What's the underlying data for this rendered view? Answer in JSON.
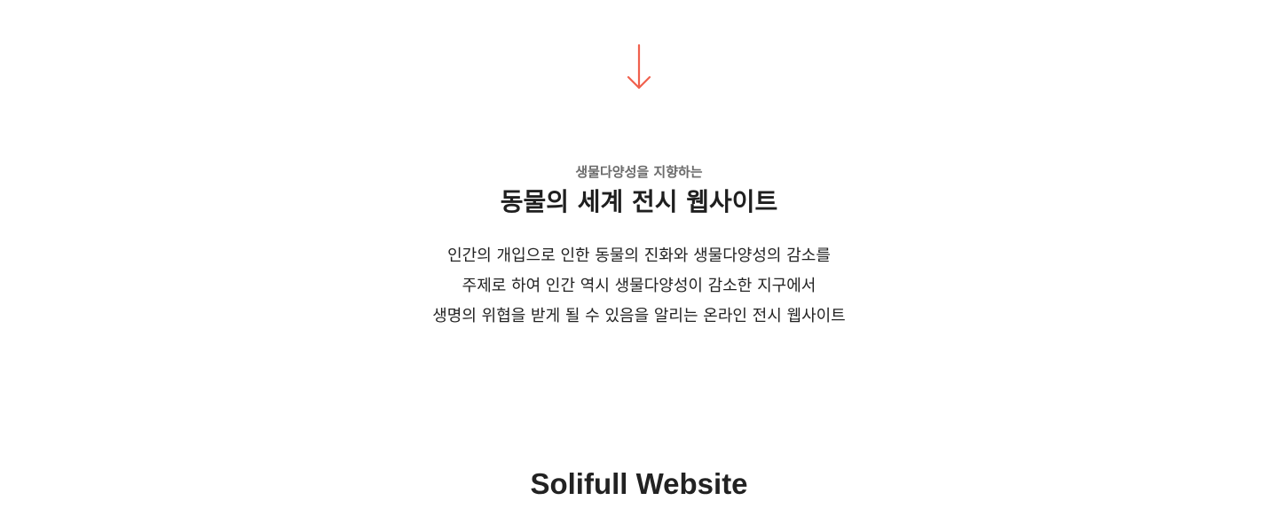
{
  "scroll_arrow": {
    "icon": "arrow-down-icon",
    "color": "#f0604d"
  },
  "intro": {
    "subtitle": "생물다양성을 지향하는",
    "title": "동물의 세계 전시 웹사이트",
    "description_lines": [
      "인간의 개입으로 인한 동물의 진화와 생물다양성의 감소를",
      "주제로 하여 인간 역시 생물다양성이 감소한 지구에서",
      "생명의 위협을 받게 될 수 있음을 알리는 온라인 전시 웹사이트"
    ]
  },
  "next_section": {
    "title": "Solifull Website"
  }
}
